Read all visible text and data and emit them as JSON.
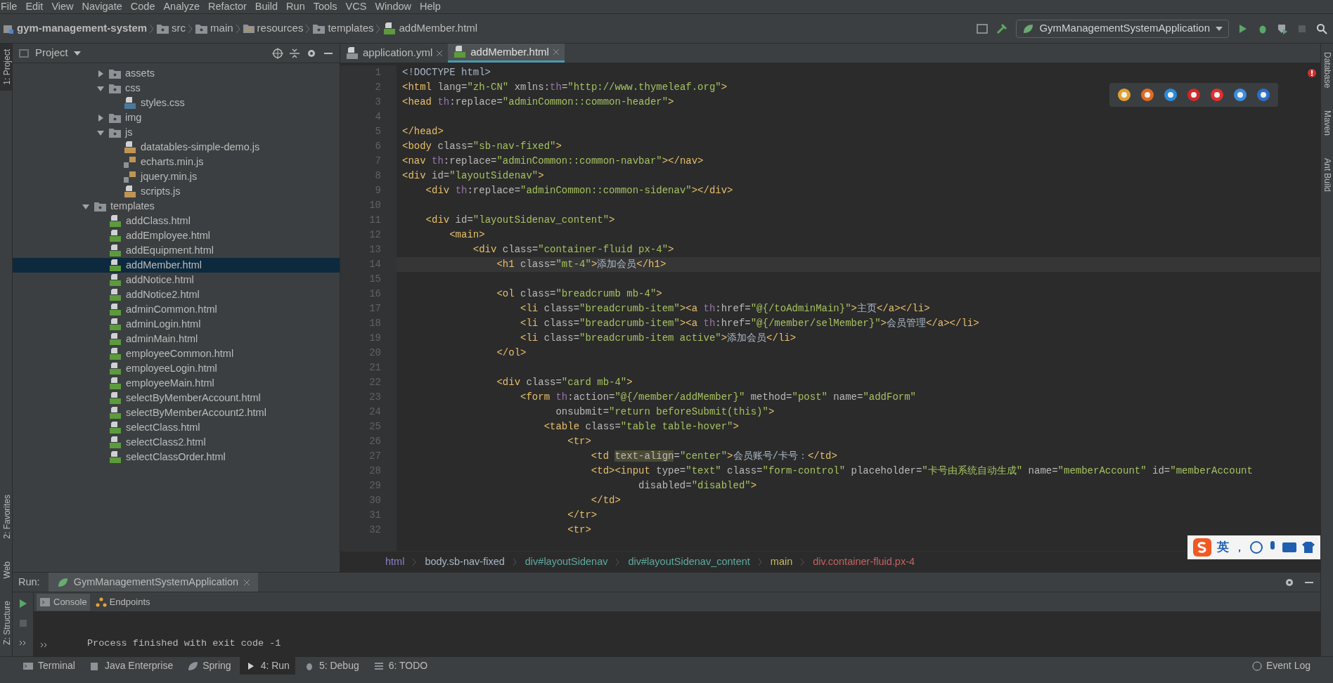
{
  "menu": [
    "File",
    "Edit",
    "View",
    "Navigate",
    "Code",
    "Analyze",
    "Refactor",
    "Build",
    "Run",
    "Tools",
    "VCS",
    "Window",
    "Help"
  ],
  "nav_path": [
    {
      "label": "gym-management-system",
      "kind": "module"
    },
    {
      "label": "src",
      "kind": "folder"
    },
    {
      "label": "main",
      "kind": "folder"
    },
    {
      "label": "resources",
      "kind": "resources"
    },
    {
      "label": "templates",
      "kind": "folder"
    },
    {
      "label": "addMember.html",
      "kind": "html"
    }
  ],
  "run_config": "GymManagementSystemApplication",
  "left_strip_top": [
    {
      "label": "1: Project",
      "selected": true
    }
  ],
  "left_strip_bottom": [
    {
      "label": "2: Favorites",
      "selected": false
    },
    {
      "label": "Web",
      "selected": false
    },
    {
      "label": "Z: Structure",
      "selected": false
    }
  ],
  "right_strip": [
    "Database",
    "Maven",
    "Ant Build"
  ],
  "project_panel": {
    "title": "Project"
  },
  "tree": [
    {
      "children": [
        {
          "label": "assets",
          "kind": "folder",
          "expanded": false,
          "selected": false
        },
        {
          "label": "css",
          "kind": "folder",
          "expanded": true,
          "selected": false,
          "children": [
            {
              "label": "styles.css",
              "kind": "css",
              "selected": false
            }
          ]
        },
        {
          "label": "img",
          "kind": "folder",
          "expanded": false,
          "selected": false
        },
        {
          "label": "js",
          "kind": "folder",
          "expanded": true,
          "selected": false,
          "children": [
            {
              "label": "datatables-simple-demo.js",
              "kind": "js",
              "selected": false
            },
            {
              "label": "echarts.min.js",
              "kind": "minjs",
              "selected": false
            },
            {
              "label": "jquery.min.js",
              "kind": "minjs",
              "selected": false
            },
            {
              "label": "scripts.js",
              "kind": "js",
              "selected": false
            }
          ]
        }
      ]
    },
    {
      "label": "templates",
      "kind": "folder",
      "expanded": true,
      "selected": false,
      "children": [
        {
          "label": "addClass.html",
          "kind": "html",
          "selected": false
        },
        {
          "label": "addEmployee.html",
          "kind": "html",
          "selected": false
        },
        {
          "label": "addEquipment.html",
          "kind": "html",
          "selected": false
        },
        {
          "label": "addMember.html",
          "kind": "html",
          "selected": true
        },
        {
          "label": "addNotice.html",
          "kind": "html",
          "selected": false
        },
        {
          "label": "addNotice2.html",
          "kind": "html",
          "selected": false
        },
        {
          "label": "adminCommon.html",
          "kind": "html",
          "selected": false
        },
        {
          "label": "adminLogin.html",
          "kind": "html",
          "selected": false
        },
        {
          "label": "adminMain.html",
          "kind": "html",
          "selected": false
        },
        {
          "label": "employeeCommon.html",
          "kind": "html",
          "selected": false
        },
        {
          "label": "employeeLogin.html",
          "kind": "html",
          "selected": false
        },
        {
          "label": "employeeMain.html",
          "kind": "html",
          "selected": false
        },
        {
          "label": "selectByMemberAccount.html",
          "kind": "html",
          "selected": false
        },
        {
          "label": "selectByMemberAccount2.html",
          "kind": "html",
          "selected": false
        },
        {
          "label": "selectClass.html",
          "kind": "html",
          "selected": false
        },
        {
          "label": "selectClass2.html",
          "kind": "html",
          "selected": false
        },
        {
          "label": "selectClassOrder.html",
          "kind": "html",
          "selected": false
        }
      ]
    }
  ],
  "editor_tabs": [
    {
      "label": "application.yml",
      "kind": "yml",
      "selected": false
    },
    {
      "label": "addMember.html",
      "kind": "html",
      "selected": true
    }
  ],
  "code": [
    {
      "n": "1",
      "current": false,
      "tokens": [
        {
          "kind": "text",
          "text": "<!DOCTYPE html>"
        }
      ]
    },
    {
      "n": "2",
      "current": false,
      "tokens": [
        {
          "kind": "tag",
          "text": "<html"
        },
        {
          "kind": "attr",
          "text": " lang="
        },
        {
          "kind": "value",
          "text": "\"zh-CN\""
        },
        {
          "kind": "attr",
          "text": " xmlns:"
        },
        {
          "kind": "ns",
          "text": "th"
        },
        {
          "kind": "attr",
          "text": "="
        },
        {
          "kind": "value",
          "text": "\"http://www.thymeleaf.org\""
        },
        {
          "kind": "tag",
          "text": ">"
        }
      ]
    },
    {
      "n": "3",
      "current": false,
      "tokens": [
        {
          "kind": "tag",
          "text": "<head "
        },
        {
          "kind": "ns",
          "text": "th"
        },
        {
          "kind": "attr",
          "text": ":replace="
        },
        {
          "kind": "value",
          "text": "\"adminCommon::common-header\""
        },
        {
          "kind": "tag",
          "text": ">"
        }
      ]
    },
    {
      "n": "4",
      "current": false
    },
    {
      "n": "5",
      "current": false,
      "tokens": [
        {
          "kind": "tag",
          "text": "</head>"
        }
      ]
    },
    {
      "n": "6",
      "current": false,
      "tokens": [
        {
          "kind": "tag",
          "text": "<body"
        },
        {
          "kind": "attr",
          "text": " class="
        },
        {
          "kind": "value",
          "text": "\"sb-nav-fixed\""
        },
        {
          "kind": "tag",
          "text": ">"
        }
      ]
    },
    {
      "n": "7",
      "current": false,
      "tokens": [
        {
          "kind": "tag",
          "text": "<nav "
        },
        {
          "kind": "ns",
          "text": "th"
        },
        {
          "kind": "attr",
          "text": ":replace="
        },
        {
          "kind": "value",
          "text": "\"adminCommon::common-navbar\""
        },
        {
          "kind": "tag",
          "text": "></nav>"
        }
      ]
    },
    {
      "n": "8",
      "current": false,
      "tokens": [
        {
          "kind": "tag",
          "text": "<div"
        },
        {
          "kind": "attr",
          "text": " id="
        },
        {
          "kind": "value",
          "text": "\"layoutSidenav\""
        },
        {
          "kind": "tag",
          "text": ">"
        }
      ]
    },
    {
      "n": "9",
      "current": false,
      "tokens": [
        {
          "kind": "tag",
          "text": "    <div "
        },
        {
          "kind": "ns",
          "text": "th"
        },
        {
          "kind": "attr",
          "text": ":replace="
        },
        {
          "kind": "value",
          "text": "\"adminCommon::common-sidenav\""
        },
        {
          "kind": "tag",
          "text": "></div>"
        }
      ]
    },
    {
      "n": "10",
      "current": false
    },
    {
      "n": "11",
      "current": false,
      "tokens": [
        {
          "kind": "tag",
          "text": "    <div"
        },
        {
          "kind": "attr",
          "text": " id="
        },
        {
          "kind": "value",
          "text": "\"layoutSidenav_content\""
        },
        {
          "kind": "tag",
          "text": ">"
        }
      ]
    },
    {
      "n": "12",
      "current": false,
      "tokens": [
        {
          "kind": "tag",
          "text": "        <main>"
        }
      ]
    },
    {
      "n": "13",
      "current": false,
      "tokens": [
        {
          "kind": "tag",
          "text": "            <div"
        },
        {
          "kind": "attr",
          "text": " class="
        },
        {
          "kind": "value",
          "text": "\"container-fluid px-4\""
        },
        {
          "kind": "tag",
          "text": ">"
        }
      ]
    },
    {
      "n": "14",
      "current": true,
      "tokens": [
        {
          "kind": "tag",
          "text": "                <h1"
        },
        {
          "kind": "attr",
          "text": " class="
        },
        {
          "kind": "value",
          "text": "\"mt-4\""
        },
        {
          "kind": "tag",
          "text": ">"
        },
        {
          "kind": "text",
          "text": "添加会员"
        },
        {
          "kind": "tag",
          "text": "</h1>"
        }
      ]
    },
    {
      "n": "15",
      "current": false
    },
    {
      "n": "16",
      "current": false,
      "tokens": [
        {
          "kind": "tag",
          "text": "                <ol"
        },
        {
          "kind": "attr",
          "text": " class="
        },
        {
          "kind": "value",
          "text": "\"breadcrumb mb-4\""
        },
        {
          "kind": "tag",
          "text": ">"
        }
      ]
    },
    {
      "n": "17",
      "current": false,
      "tokens": [
        {
          "kind": "tag",
          "text": "                    <li"
        },
        {
          "kind": "attr",
          "text": " class="
        },
        {
          "kind": "value",
          "text": "\"breadcrumb-item\""
        },
        {
          "kind": "tag",
          "text": "><a "
        },
        {
          "kind": "ns",
          "text": "th"
        },
        {
          "kind": "attr",
          "text": ":href="
        },
        {
          "kind": "value",
          "text": "\"@{/toAdminMain}\""
        },
        {
          "kind": "tag",
          "text": ">"
        },
        {
          "kind": "text",
          "text": "主页"
        },
        {
          "kind": "tag",
          "text": "</a></li>"
        }
      ]
    },
    {
      "n": "18",
      "current": false,
      "tokens": [
        {
          "kind": "tag",
          "text": "                    <li"
        },
        {
          "kind": "attr",
          "text": " class="
        },
        {
          "kind": "value",
          "text": "\"breadcrumb-item\""
        },
        {
          "kind": "tag",
          "text": "><a "
        },
        {
          "kind": "ns",
          "text": "th"
        },
        {
          "kind": "attr",
          "text": ":href="
        },
        {
          "kind": "value",
          "text": "\"@{/member/selMember}\""
        },
        {
          "kind": "tag",
          "text": ">"
        },
        {
          "kind": "text",
          "text": "会员管理"
        },
        {
          "kind": "tag",
          "text": "</a></li>"
        }
      ]
    },
    {
      "n": "19",
      "current": false,
      "tokens": [
        {
          "kind": "tag",
          "text": "                    <li"
        },
        {
          "kind": "attr",
          "text": " class="
        },
        {
          "kind": "value",
          "text": "\"breadcrumb-item active\""
        },
        {
          "kind": "tag",
          "text": ">"
        },
        {
          "kind": "text",
          "text": "添加会员"
        },
        {
          "kind": "tag",
          "text": "</li>"
        }
      ]
    },
    {
      "n": "20",
      "current": false,
      "tokens": [
        {
          "kind": "tag",
          "text": "                </ol>"
        }
      ]
    },
    {
      "n": "21",
      "current": false
    },
    {
      "n": "22",
      "current": false,
      "tokens": [
        {
          "kind": "tag",
          "text": "                <div"
        },
        {
          "kind": "attr",
          "text": " class="
        },
        {
          "kind": "value",
          "text": "\"card mb-4\""
        },
        {
          "kind": "tag",
          "text": ">"
        }
      ]
    },
    {
      "n": "23",
      "current": false,
      "tokens": [
        {
          "kind": "tag",
          "text": "                    <form "
        },
        {
          "kind": "ns",
          "text": "th"
        },
        {
          "kind": "attr",
          "text": ":action="
        },
        {
          "kind": "value",
          "text": "\"@{/member/addMember}\""
        },
        {
          "kind": "attr",
          "text": " method="
        },
        {
          "kind": "value",
          "text": "\"post\""
        },
        {
          "kind": "attr",
          "text": " name="
        },
        {
          "kind": "value",
          "text": "\"addForm\""
        }
      ]
    },
    {
      "n": "24",
      "current": false,
      "tokens": [
        {
          "kind": "attr",
          "text": "                          onsubmit="
        },
        {
          "kind": "value",
          "text": "\"return beforeSubmit(this)\""
        },
        {
          "kind": "tag",
          "text": ">"
        }
      ]
    },
    {
      "n": "25",
      "current": false,
      "tokens": [
        {
          "kind": "tag",
          "text": "                        <table"
        },
        {
          "kind": "attr",
          "text": " class="
        },
        {
          "kind": "value",
          "text": "\"table table-hover\""
        },
        {
          "kind": "tag",
          "text": ">"
        }
      ]
    },
    {
      "n": "26",
      "current": false,
      "tokens": [
        {
          "kind": "tag",
          "text": "                            <tr>"
        }
      ]
    },
    {
      "n": "27",
      "current": false,
      "tokens": [
        {
          "kind": "tag",
          "text": "                                <td "
        },
        {
          "kind": "warn",
          "text": "text-align"
        },
        {
          "kind": "attr",
          "text": "="
        },
        {
          "kind": "value",
          "text": "\"center\""
        },
        {
          "kind": "tag",
          "text": ">"
        },
        {
          "kind": "text",
          "text": "会员账号/卡号："
        },
        {
          "kind": "tag",
          "text": "</td>"
        }
      ]
    },
    {
      "n": "28",
      "current": false,
      "tokens": [
        {
          "kind": "tag",
          "text": "                                <td><input"
        },
        {
          "kind": "attr",
          "text": " type="
        },
        {
          "kind": "value",
          "text": "\"text\""
        },
        {
          "kind": "attr",
          "text": " class="
        },
        {
          "kind": "value",
          "text": "\"form-control\""
        },
        {
          "kind": "attr",
          "text": " placeholder="
        },
        {
          "kind": "value",
          "text": "\"卡号由系统自动生成\""
        },
        {
          "kind": "attr",
          "text": " name="
        },
        {
          "kind": "value",
          "text": "\"memberAccount\""
        },
        {
          "kind": "attr",
          "text": " id="
        },
        {
          "kind": "value",
          "text": "\"memberAccount"
        }
      ]
    },
    {
      "n": "29",
      "current": false,
      "tokens": [
        {
          "kind": "attr",
          "text": "                                        disabled="
        },
        {
          "kind": "value",
          "text": "\"disabled\""
        },
        {
          "kind": "tag",
          "text": ">"
        }
      ]
    },
    {
      "n": "30",
      "current": false,
      "tokens": [
        {
          "kind": "tag",
          "text": "                                </td>"
        }
      ]
    },
    {
      "n": "31",
      "current": false,
      "tokens": [
        {
          "kind": "tag",
          "text": "                            </tr>"
        }
      ]
    },
    {
      "n": "32",
      "current": false,
      "tokens": [
        {
          "kind": "tag",
          "text": "                            <tr>"
        }
      ]
    }
  ],
  "editor_breadcrumb": [
    {
      "label": "html",
      "color": "#8b7fc4"
    },
    {
      "label": "body.sb-nav-fixed",
      "color": "#a9b7c6"
    },
    {
      "label": "div#layoutSidenav",
      "color": "#5fa9a0"
    },
    {
      "label": "div#layoutSidenav_content",
      "color": "#5fa9a0"
    },
    {
      "label": "main",
      "color": "#c9b75a"
    },
    {
      "label": "div.container-fluid.px-4",
      "color": "#c76161"
    }
  ],
  "ime": {
    "lang": "英",
    "punct": "，"
  },
  "run_panel": {
    "title": "Run:",
    "tab": "GymManagementSystemApplication",
    "subtabs": [
      {
        "label": "Console",
        "kind": "console",
        "selected": true
      },
      {
        "label": "Endpoints",
        "kind": "endpoints",
        "selected": false
      }
    ],
    "console": [
      "Process finished with exit code -1"
    ]
  },
  "bottom_tools": [
    {
      "label": "Terminal",
      "kind": "terminal",
      "selected": false
    },
    {
      "label": "Java Enterprise",
      "kind": "javaee",
      "selected": false
    },
    {
      "label": "Spring",
      "kind": "spring",
      "selected": false
    },
    {
      "label": "4: Run",
      "kind": "run",
      "selected": true
    },
    {
      "label": "5: Debug",
      "kind": "debug",
      "selected": false
    },
    {
      "label": "6: TODO",
      "kind": "todo",
      "selected": false
    }
  ],
  "event_log": "Event Log"
}
